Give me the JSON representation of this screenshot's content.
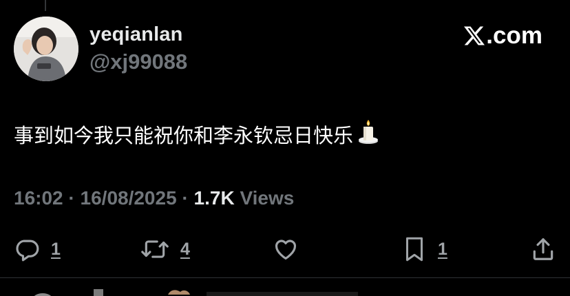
{
  "user": {
    "display_name": "yeqianlan",
    "handle": "@xj99088"
  },
  "brand": {
    "text": ".com"
  },
  "tweet": {
    "text": "事到如今我只能祝你和李永钦忌日快乐",
    "emoji_icon": "candle-icon"
  },
  "meta": {
    "time": "16:02",
    "date": "16/08/2025",
    "separator": " · ",
    "views_count": "1.7K",
    "views_label": " Views"
  },
  "actions": {
    "reply_count": "1",
    "retweet_count": "4",
    "bookmark_count": "1"
  },
  "colors": {
    "background": "#000000",
    "primary_text": "#e7e9ea",
    "secondary_text": "#71767b",
    "divider": "#2f3336"
  }
}
